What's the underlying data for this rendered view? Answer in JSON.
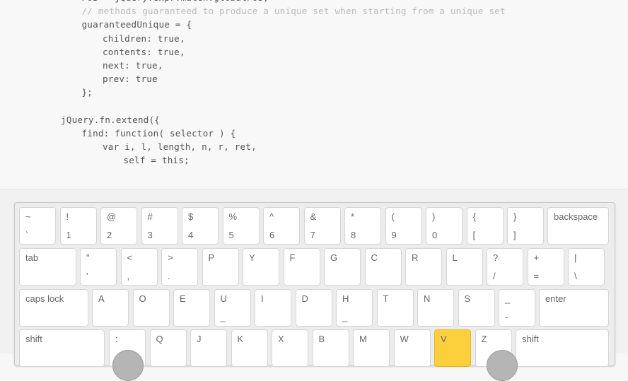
{
  "code": {
    "lines": [
      {
        "indent": 1,
        "text": "POS = jQuery.expr.match.globalPOS,",
        "comment": false
      },
      {
        "indent": 1,
        "text": "// methods guaranteed to produce a unique set when starting from a unique set",
        "comment": true
      },
      {
        "indent": 1,
        "text": "guaranteedUnique = {",
        "comment": false
      },
      {
        "indent": 2,
        "text": "children: true,",
        "comment": false
      },
      {
        "indent": 2,
        "text": "contents: true,",
        "comment": false
      },
      {
        "indent": 2,
        "text": "next: true,",
        "comment": false
      },
      {
        "indent": 2,
        "text": "prev: true",
        "comment": false
      },
      {
        "indent": 1,
        "text": "};",
        "comment": false
      },
      {
        "indent": 0,
        "text": "",
        "comment": false
      },
      {
        "indent": 0,
        "text": "jQuery.fn.extend({",
        "comment": false
      },
      {
        "indent": 1,
        "text": "find: function( selector ) {",
        "comment": false
      },
      {
        "indent": 2,
        "text": "var i, l, length, n, r, ret,",
        "comment": false
      },
      {
        "indent": 3,
        "text": "self = this;",
        "comment": false
      }
    ]
  },
  "keyboard": {
    "highlight_color": "#fccf3c",
    "highlighted_key": "V",
    "rows": [
      [
        [
          "~",
          "`"
        ],
        [
          "!",
          "1"
        ],
        [
          "@",
          "2"
        ],
        [
          "#",
          "3"
        ],
        [
          "$",
          "4"
        ],
        [
          "%",
          "5"
        ],
        [
          "^",
          "6"
        ],
        [
          "&",
          "7"
        ],
        [
          "*",
          "8"
        ],
        [
          "(",
          "9"
        ],
        [
          ")",
          "0"
        ],
        [
          "{",
          "["
        ],
        [
          "}",
          "]"
        ],
        [
          "backspace",
          ""
        ]
      ],
      [
        [
          "tab",
          ""
        ],
        [
          "\"",
          "'"
        ],
        [
          "<",
          ","
        ],
        [
          ">",
          "."
        ],
        [
          "P",
          ""
        ],
        [
          "Y",
          ""
        ],
        [
          "F",
          ""
        ],
        [
          "G",
          ""
        ],
        [
          "C",
          ""
        ],
        [
          "R",
          ""
        ],
        [
          "L",
          ""
        ],
        [
          "?",
          "/"
        ],
        [
          "+",
          "="
        ],
        [
          "|",
          "\\"
        ]
      ],
      [
        [
          "caps lock",
          ""
        ],
        [
          "A",
          ""
        ],
        [
          "O",
          ""
        ],
        [
          "E",
          ""
        ],
        [
          "U",
          "_"
        ],
        [
          "I",
          ""
        ],
        [
          "D",
          ""
        ],
        [
          "H",
          "_"
        ],
        [
          "T",
          ""
        ],
        [
          "N",
          ""
        ],
        [
          "S",
          ""
        ],
        [
          "_",
          "-"
        ],
        [
          "enter",
          ""
        ]
      ],
      [
        [
          "shift",
          ""
        ],
        [
          ":",
          ""
        ],
        [
          "Q",
          ""
        ],
        [
          "J",
          ""
        ],
        [
          "K",
          ""
        ],
        [
          "X",
          ""
        ],
        [
          "B",
          ""
        ],
        [
          "M",
          ""
        ],
        [
          "W",
          ""
        ],
        [
          "V",
          ""
        ],
        [
          "Z",
          ""
        ],
        [
          "shift",
          ""
        ]
      ]
    ]
  }
}
